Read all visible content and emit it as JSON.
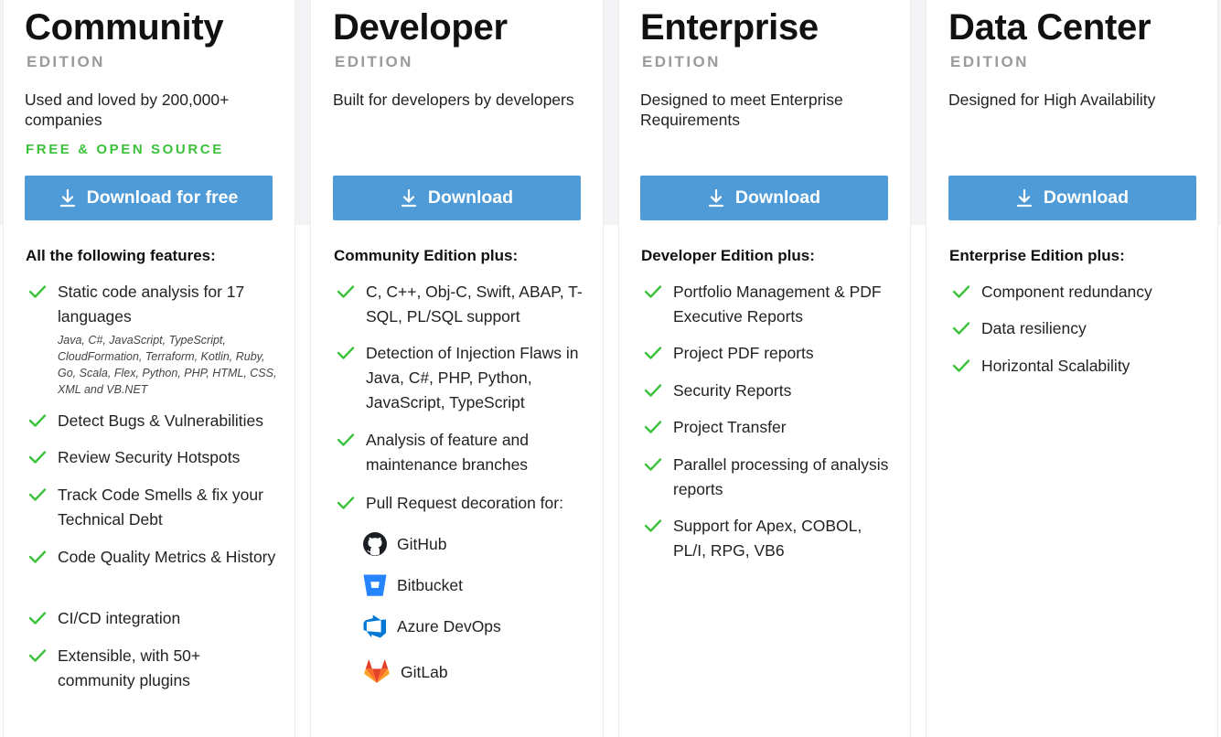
{
  "colors": {
    "accent": "#4e9bd8",
    "free": "#3cc13b",
    "check": "#3cc13b",
    "edition": "#9a9a9a"
  },
  "plans": [
    {
      "title": "Community",
      "edition": "EDITION",
      "tagline": "Used and loved by 200,000+ companies",
      "badge": "FREE & OPEN SOURCE",
      "button": "Download for free",
      "features_heading": "All the following features:",
      "features": [
        "Static code analysis for 17 languages",
        "Detect Bugs & Vulnerabilities",
        "Review Security Hotspots",
        "Track Code Smells & fix your Technical Debt",
        "Code Quality Metrics & History",
        "CI/CD integration",
        "Extensible, with 50+ community plugins"
      ],
      "languages_note": "Java, C#, JavaScript, TypeScript, CloudFormation, Terraform, Kotlin, Ruby, Go, Scala, Flex, Python, PHP, HTML, CSS, XML and VB.NET"
    },
    {
      "title": "Developer",
      "edition": "EDITION",
      "tagline": "Built for developers by developers",
      "button": "Download",
      "features_heading": "Community Edition plus:",
      "features": [
        "C, C++, Obj-C, Swift, ABAP, T-SQL, PL/SQL support",
        "Detection of Injection Flaws in Java, C#, PHP, Python, JavaScript, TypeScript",
        "Analysis of feature and maintenance branches",
        "Pull Request decoration for:"
      ],
      "integrations": [
        {
          "label": "GitHub",
          "icon": "github-icon"
        },
        {
          "label": "Bitbucket",
          "icon": "bitbucket-icon"
        },
        {
          "label": "Azure DevOps",
          "icon": "azure-devops-icon"
        },
        {
          "label": "GitLab",
          "icon": "gitlab-icon"
        }
      ]
    },
    {
      "title": "Enterprise",
      "edition": "EDITION",
      "tagline": "Designed to meet Enterprise Requirements",
      "button": "Download",
      "features_heading": "Developer Edition plus:",
      "features": [
        "Portfolio Management & PDF Executive Reports",
        "Project PDF reports",
        "Security Reports",
        "Project Transfer",
        "Parallel processing of analysis reports",
        "Support for Apex, COBOL, PL/I, RPG, VB6"
      ]
    },
    {
      "title": "Data Center",
      "edition": "EDITION",
      "tagline": "Designed for High Availability",
      "button": "Download",
      "features_heading": "Enterprise Edition plus:",
      "features": [
        "Component redundancy",
        "Data resiliency",
        "Horizontal Scalability"
      ]
    }
  ]
}
